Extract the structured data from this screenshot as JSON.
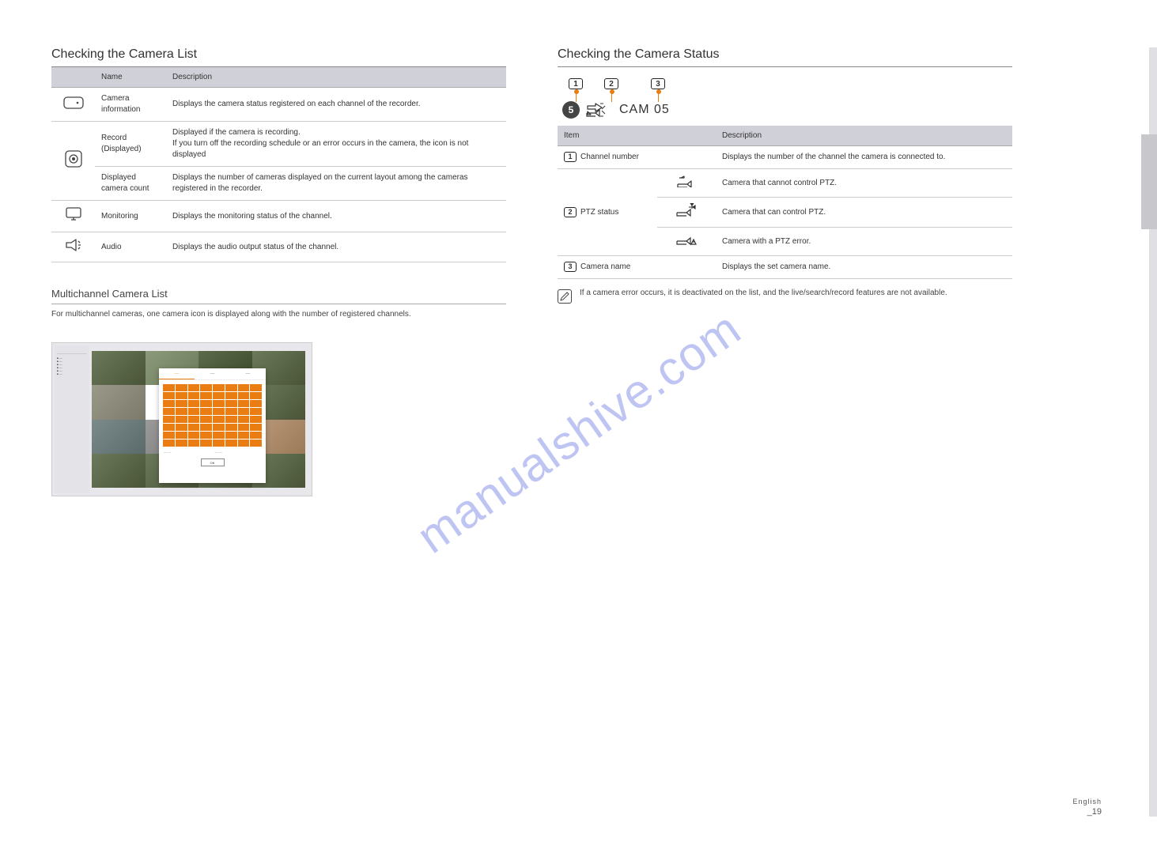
{
  "left": {
    "section_title": "Checking the Camera List",
    "table_header_name": "Name",
    "table_header_desc": "Description",
    "rows": [
      {
        "icon": "rect-dot",
        "name": "Camera information",
        "desc": "Displays the camera status registered on each channel of the recorder.",
        "desc2": ""
      },
      {
        "icon": "record",
        "name": "Record (Displayed)",
        "desc": "Displayed if the camera is recording.",
        "desc2": "If you turn off the recording schedule or an error occurs in the camera, the icon is not displayed"
      },
      {
        "icon": "record",
        "name": "Displayed camera count",
        "desc": "Displays the number of cameras displayed on the current layout among the cameras registered in the recorder.",
        "desc2": ""
      },
      {
        "icon": "monitor",
        "name": "Monitoring",
        "desc": "Displays the monitoring status of the channel.",
        "desc2": ""
      },
      {
        "icon": "speaker",
        "name": "Audio",
        "desc": "Displays the audio output status of the channel.",
        "desc2": ""
      }
    ],
    "sub_title": "Multichannel Camera List",
    "sub_para": "For multichannel cameras, one camera icon is displayed along with the number of registered channels."
  },
  "right": {
    "section_title": "Checking the Camera Status",
    "cam_label": "CAM 05",
    "items_header_item": "Item",
    "items_header_desc": "Description",
    "items": [
      {
        "idx": "1",
        "name": "Channel number",
        "desc": "Displays the number of the channel the camera is connected to."
      },
      {
        "idx": "2",
        "name": "PTZ status",
        "sub": [
          {
            "icon": "ptz-off",
            "text": "Camera that cannot control PTZ."
          },
          {
            "icon": "ptz-on",
            "text": "Camera that can control PTZ."
          },
          {
            "icon": "ptz-err",
            "text": "Camera with a PTZ error."
          }
        ]
      },
      {
        "idx": "3",
        "name": "Camera name",
        "desc": "Displays the set camera name."
      }
    ],
    "note": "If a camera error occurs, it is deactivated on the list, and the live/search/record features are not available."
  },
  "footer": {
    "eng_label": "English",
    "page_no": "_19"
  },
  "watermark": "manualshive.com"
}
